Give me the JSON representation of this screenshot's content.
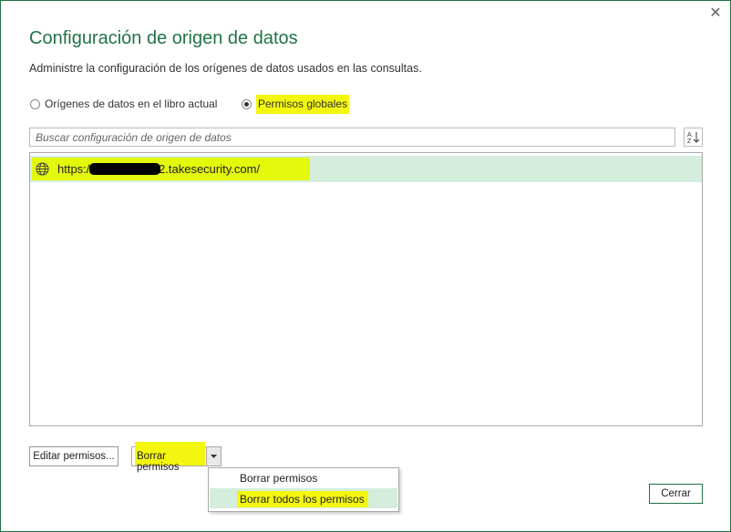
{
  "dialog": {
    "title": "Configuración de origen de datos",
    "description": "Administre la configuración de los orígenes de datos usados en las consultas.",
    "close_glyph": "✕"
  },
  "scope": {
    "option_current": "Orígenes de datos en el libro actual",
    "option_global": "Permisos globales",
    "selected": "global"
  },
  "search": {
    "placeholder": "Buscar configuración de origen de datos"
  },
  "sources": [
    {
      "url_prefix": "https://",
      "url_suffix": "2.takesecurity.com/",
      "icon": "globe-icon",
      "selected": true
    }
  ],
  "buttons": {
    "edit_permissions": "Editar permisos...",
    "clear_permissions": "Borrar permisos",
    "close": "Cerrar"
  },
  "dropdown_menu": {
    "items": [
      "Borrar permisos",
      "Borrar todos los permisos"
    ],
    "hovered_index": 1
  },
  "colors": {
    "accent": "#217346",
    "highlight": "#f3f70f",
    "selection": "#d4eddd"
  }
}
